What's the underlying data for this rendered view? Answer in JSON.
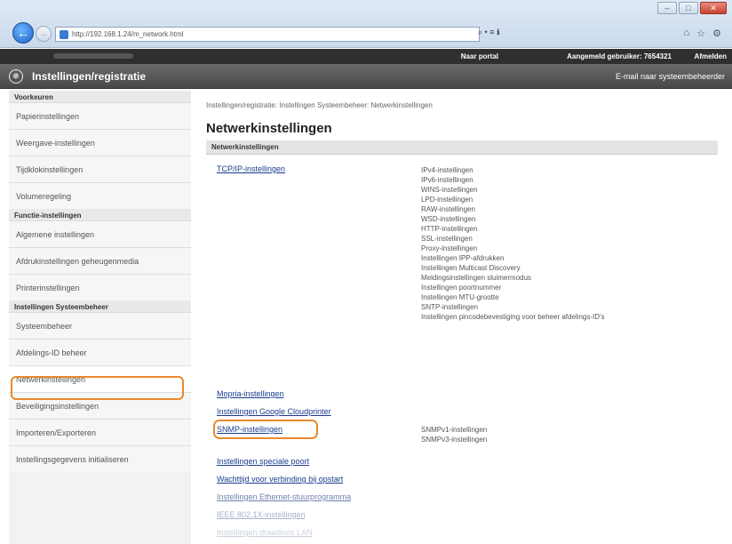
{
  "browser": {
    "url": "http://192.168.1.24/m_network.html",
    "tools": "⌕ • ≡ ℹ"
  },
  "topbar": {
    "portal": "Naar portal",
    "login": "Aangemeld gebruiker: 7654321",
    "logout": "Afmelden"
  },
  "header": {
    "title": "Instellingen/registratie",
    "email": "E-mail naar systeembeheerder"
  },
  "sidebar": {
    "sections": [
      {
        "title": "Voorkeuren",
        "items": [
          "Papierinstellingen",
          "Weergave-instellingen",
          "Tijdklokinstellingen",
          "Volumeregeling"
        ]
      },
      {
        "title": "Functie-instellingen",
        "items": [
          "Algemene instellingen",
          "Afdrukinstellingen geheugenmedia",
          "Printerinstellingen"
        ]
      },
      {
        "title": "Instellingen Systeembeheer",
        "items": [
          "Systeembeheer",
          "Afdelings-ID beheer",
          "Netwerkinstellingen",
          "Beveiligingsinstellingen",
          "Importeren/Exporteren",
          "Instellingsgegevens initialiseren"
        ]
      }
    ]
  },
  "main": {
    "breadcrumb": "Instellingen/registratie: Instellingen Systeembeheer: Netwerkinstellingen",
    "title": "Netwerkinstellingen",
    "section": "Netwerkinstellingen",
    "tcpip_link": "TCP/IP-instellingen",
    "tcpip_items": [
      "IPv4-instellingen",
      "IPv6-instellingen",
      "WINS-instellingen",
      "LPD-instellingen",
      "RAW-instellingen",
      "WSD-instellingen",
      "HTTP-instellingen",
      "SSL-instellingen",
      "Proxy-instellingen",
      "Instellingen IPP-afdrukken",
      "Instellingen Multicast Discovery",
      "Meldingsinstellingen sluimermodus",
      "Instellingen poortnummer",
      "Instellingen MTU-grootte",
      "SNTP-instellingen",
      "Instellingen pincodebevestiging voor beheer afdelings-ID's"
    ],
    "mopria_link": "Mopria-instellingen",
    "google_link": "Instellingen Google Cloudprinter",
    "snmp_link": "SNMP-instellingen",
    "snmp_items": [
      "SNMPv1-instellingen",
      "SNMPv3-instellingen"
    ],
    "special_port_link": "Instellingen speciale poort",
    "wait_link": "Wachttijd voor verbinding bij opstart",
    "ethernet_link": "Instellingen Ethernet-stuurprogramma",
    "ieee_link": "IEEE 802.1X-instellingen",
    "wlan_link": "Instellingen draadloos LAN"
  }
}
